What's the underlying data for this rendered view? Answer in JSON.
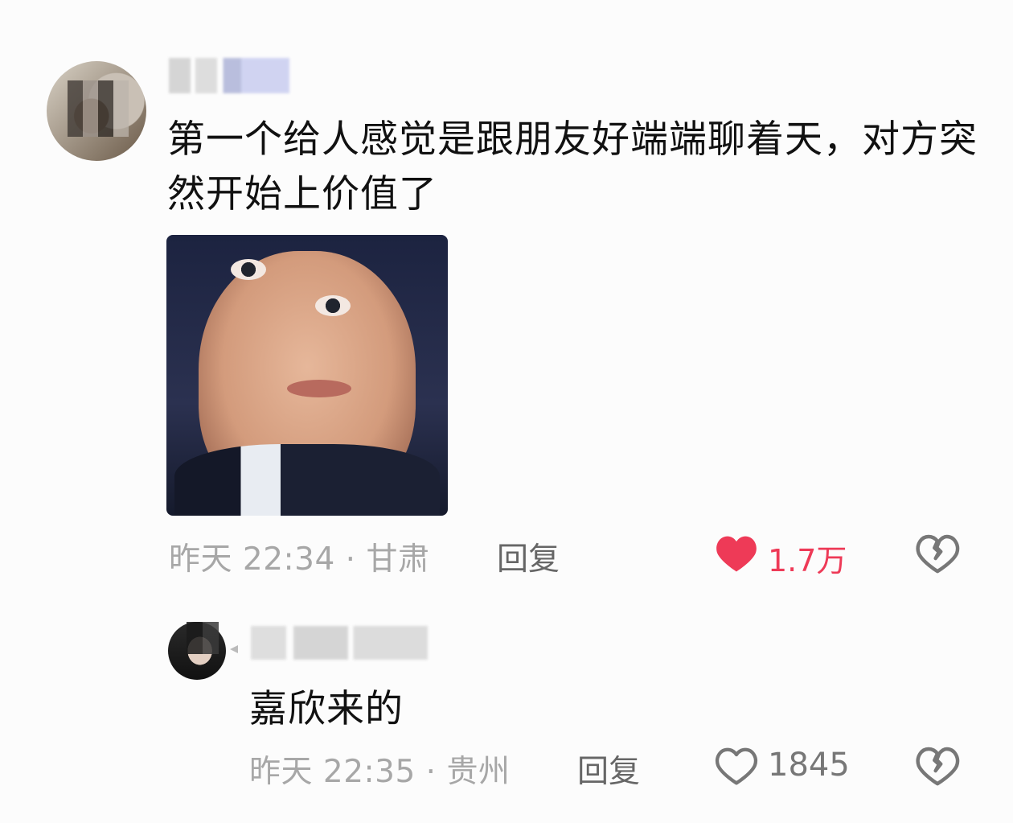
{
  "comments": [
    {
      "text": "第一个给人感觉是跟朋友好端端聊着天，对方突然开始上价值了",
      "meta": "昨天 22:34 · 甘肃",
      "reply_label": "回复",
      "likes": "1.7万",
      "liked": true,
      "icons": {
        "like": "heart-filled-icon",
        "dislike": "broken-heart-icon"
      }
    },
    {
      "text": "嘉欣来的",
      "meta": "昨天 22:35 · 贵州",
      "reply_label": "回复",
      "likes": "1845",
      "liked": false,
      "icons": {
        "like": "heart-outline-icon",
        "dislike": "broken-heart-icon"
      }
    }
  ],
  "colors": {
    "like_active": "#ee3a57",
    "meta_text": "#a7a7a7",
    "body_text": "#111111",
    "background": "#fcfcfc"
  }
}
